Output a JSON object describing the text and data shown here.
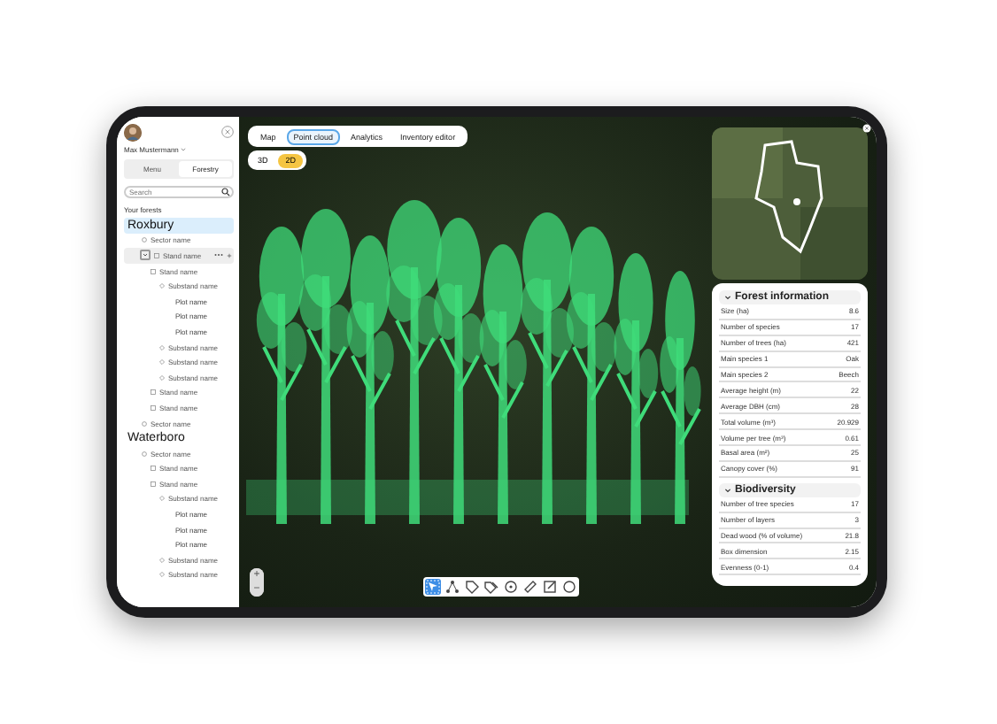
{
  "user": {
    "name": "Max Mustermann"
  },
  "sidebar_tabs": [
    {
      "label": "Menu",
      "selected": false
    },
    {
      "label": "Forestry",
      "selected": true
    }
  ],
  "search": {
    "placeholder": "Search"
  },
  "forests_heading": "Your forests",
  "tree": [
    {
      "label": "Roxbury",
      "kind": "forest",
      "selected": true,
      "children": [
        {
          "label": "Sector name",
          "kind": "sector",
          "selected": false,
          "children": [
            {
              "label": "Stand name",
              "kind": "stand",
              "selected": false,
              "hovered": true,
              "expanded": true
            },
            {
              "label": "Stand name",
              "kind": "stand",
              "selected": false,
              "children": [
                {
                  "label": "Substand name",
                  "kind": "substand",
                  "selected": false,
                  "children": [
                    {
                      "label": "Plot name",
                      "kind": "plot",
                      "selected": false
                    },
                    {
                      "label": "Plot name",
                      "kind": "plot",
                      "selected": false
                    },
                    {
                      "label": "Plot name",
                      "kind": "plot",
                      "selected": false
                    }
                  ]
                },
                {
                  "label": "Substand name",
                  "kind": "substand",
                  "selected": false
                },
                {
                  "label": "Substand name",
                  "kind": "substand",
                  "selected": false
                },
                {
                  "label": "Substand name",
                  "kind": "substand",
                  "selected": false
                }
              ]
            },
            {
              "label": "Stand name",
              "kind": "stand",
              "selected": false
            },
            {
              "label": "Stand name",
              "kind": "stand",
              "selected": false
            }
          ]
        },
        {
          "label": "Sector name",
          "kind": "sector",
          "selected": false
        }
      ]
    },
    {
      "label": "Waterboro",
      "kind": "forest",
      "selected": false,
      "children": [
        {
          "label": "Sector name",
          "kind": "sector",
          "selected": false,
          "children": [
            {
              "label": "Stand name",
              "kind": "stand",
              "selected": false
            },
            {
              "label": "Stand name",
              "kind": "stand",
              "selected": false,
              "children": [
                {
                  "label": "Substand name",
                  "kind": "substand",
                  "selected": false,
                  "children": [
                    {
                      "label": "Plot name",
                      "kind": "plot",
                      "selected": false
                    },
                    {
                      "label": "Plot name",
                      "kind": "plot",
                      "selected": false
                    },
                    {
                      "label": "Plot name",
                      "kind": "plot",
                      "selected": false
                    }
                  ]
                },
                {
                  "label": "Substand name",
                  "kind": "substand",
                  "selected": false
                },
                {
                  "label": "Substand name",
                  "kind": "substand",
                  "selected": false
                }
              ]
            }
          ]
        }
      ]
    }
  ],
  "view_tabs": [
    {
      "label": "Map",
      "selected": false
    },
    {
      "label": "Point cloud",
      "selected": true
    },
    {
      "label": "Analytics",
      "selected": false
    },
    {
      "label": "Inventory editor",
      "selected": false
    }
  ],
  "view_modes": [
    {
      "label": "3D",
      "selected": false
    },
    {
      "label": "2D",
      "selected": true
    }
  ],
  "zoom_controls": [
    {
      "label": "+"
    },
    {
      "label": "−"
    }
  ],
  "tools": [
    {
      "kind": "select",
      "selected": true
    },
    {
      "kind": "nodes",
      "selected": false
    },
    {
      "kind": "tag",
      "selected": false
    },
    {
      "kind": "tags",
      "selected": false
    },
    {
      "kind": "target",
      "selected": false
    },
    {
      "kind": "ruler",
      "selected": false
    },
    {
      "kind": "edit",
      "selected": false
    },
    {
      "kind": "circle",
      "selected": false
    }
  ],
  "panels": [
    {
      "title": "Forest information",
      "expanded": true,
      "rows": [
        {
          "label": "Size (ha)",
          "value": "8.6"
        },
        {
          "label": "Number of species",
          "value": "17"
        },
        {
          "label": "Number of trees (ha)",
          "value": "421"
        },
        {
          "label": "Main species 1",
          "value": "Oak"
        },
        {
          "label": "Main species 2",
          "value": "Beech"
        },
        {
          "label": "Average height (m)",
          "value": "22"
        },
        {
          "label": "Average DBH (cm)",
          "value": "28"
        },
        {
          "label": "Total volume (m³)",
          "value": "20.929"
        },
        {
          "label": "Volume per tree (m³)",
          "value": "0.61"
        },
        {
          "label": "Basal area (m²)",
          "value": "25"
        },
        {
          "label": "Canopy cover (%)",
          "value": "91"
        }
      ]
    },
    {
      "title": "Biodiversity",
      "expanded": true,
      "rows": [
        {
          "label": "Number of tree species",
          "value": "17"
        },
        {
          "label": "Number of layers",
          "value": "3"
        },
        {
          "label": "Dead wood (% of volume)",
          "value": "21.8"
        },
        {
          "label": "Box dimension",
          "value": "2.15"
        },
        {
          "label": "Evenness (0-1)",
          "value": "0.4"
        }
      ]
    }
  ]
}
